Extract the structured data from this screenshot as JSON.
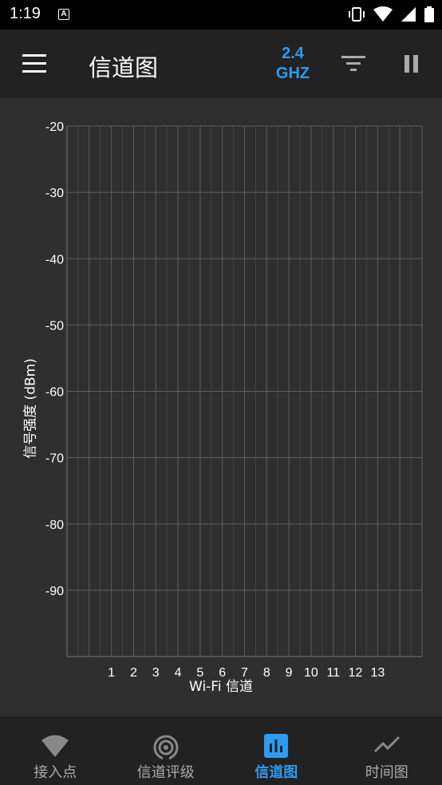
{
  "status_bar": {
    "time": "1:19",
    "notification_icon": "A"
  },
  "app_bar": {
    "title": "信道图",
    "band_line1": "2.4",
    "band_line2": "GHZ",
    "accent_color": "#2e9bf0"
  },
  "chart_data": {
    "type": "line",
    "ylabel": "信号强度 (dBm)",
    "xlabel": "Wi-Fi 信道",
    "y_ticks": [
      "-20",
      "-30",
      "-40",
      "-50",
      "-60",
      "-70",
      "-80",
      "-90"
    ],
    "y_values": [
      -20,
      -30,
      -40,
      -50,
      -60,
      -70,
      -80,
      -90
    ],
    "ylim": [
      -100,
      -20
    ],
    "x_ticks": [
      "1",
      "2",
      "3",
      "4",
      "5",
      "6",
      "7",
      "8",
      "9",
      "10",
      "11",
      "12",
      "13"
    ],
    "x_values": [
      1,
      2,
      3,
      4,
      5,
      6,
      7,
      8,
      9,
      10,
      11,
      12,
      13
    ],
    "xlim": [
      -1,
      15
    ],
    "grid": true,
    "series": []
  },
  "bottom_nav": {
    "items": [
      {
        "label": "接入点",
        "icon": "wifi-icon",
        "active": false
      },
      {
        "label": "信道评级",
        "icon": "signal-rating-icon",
        "active": false
      },
      {
        "label": "信道图",
        "icon": "bar-chart-icon",
        "active": true
      },
      {
        "label": "时间图",
        "icon": "time-graph-icon",
        "active": false
      }
    ]
  }
}
